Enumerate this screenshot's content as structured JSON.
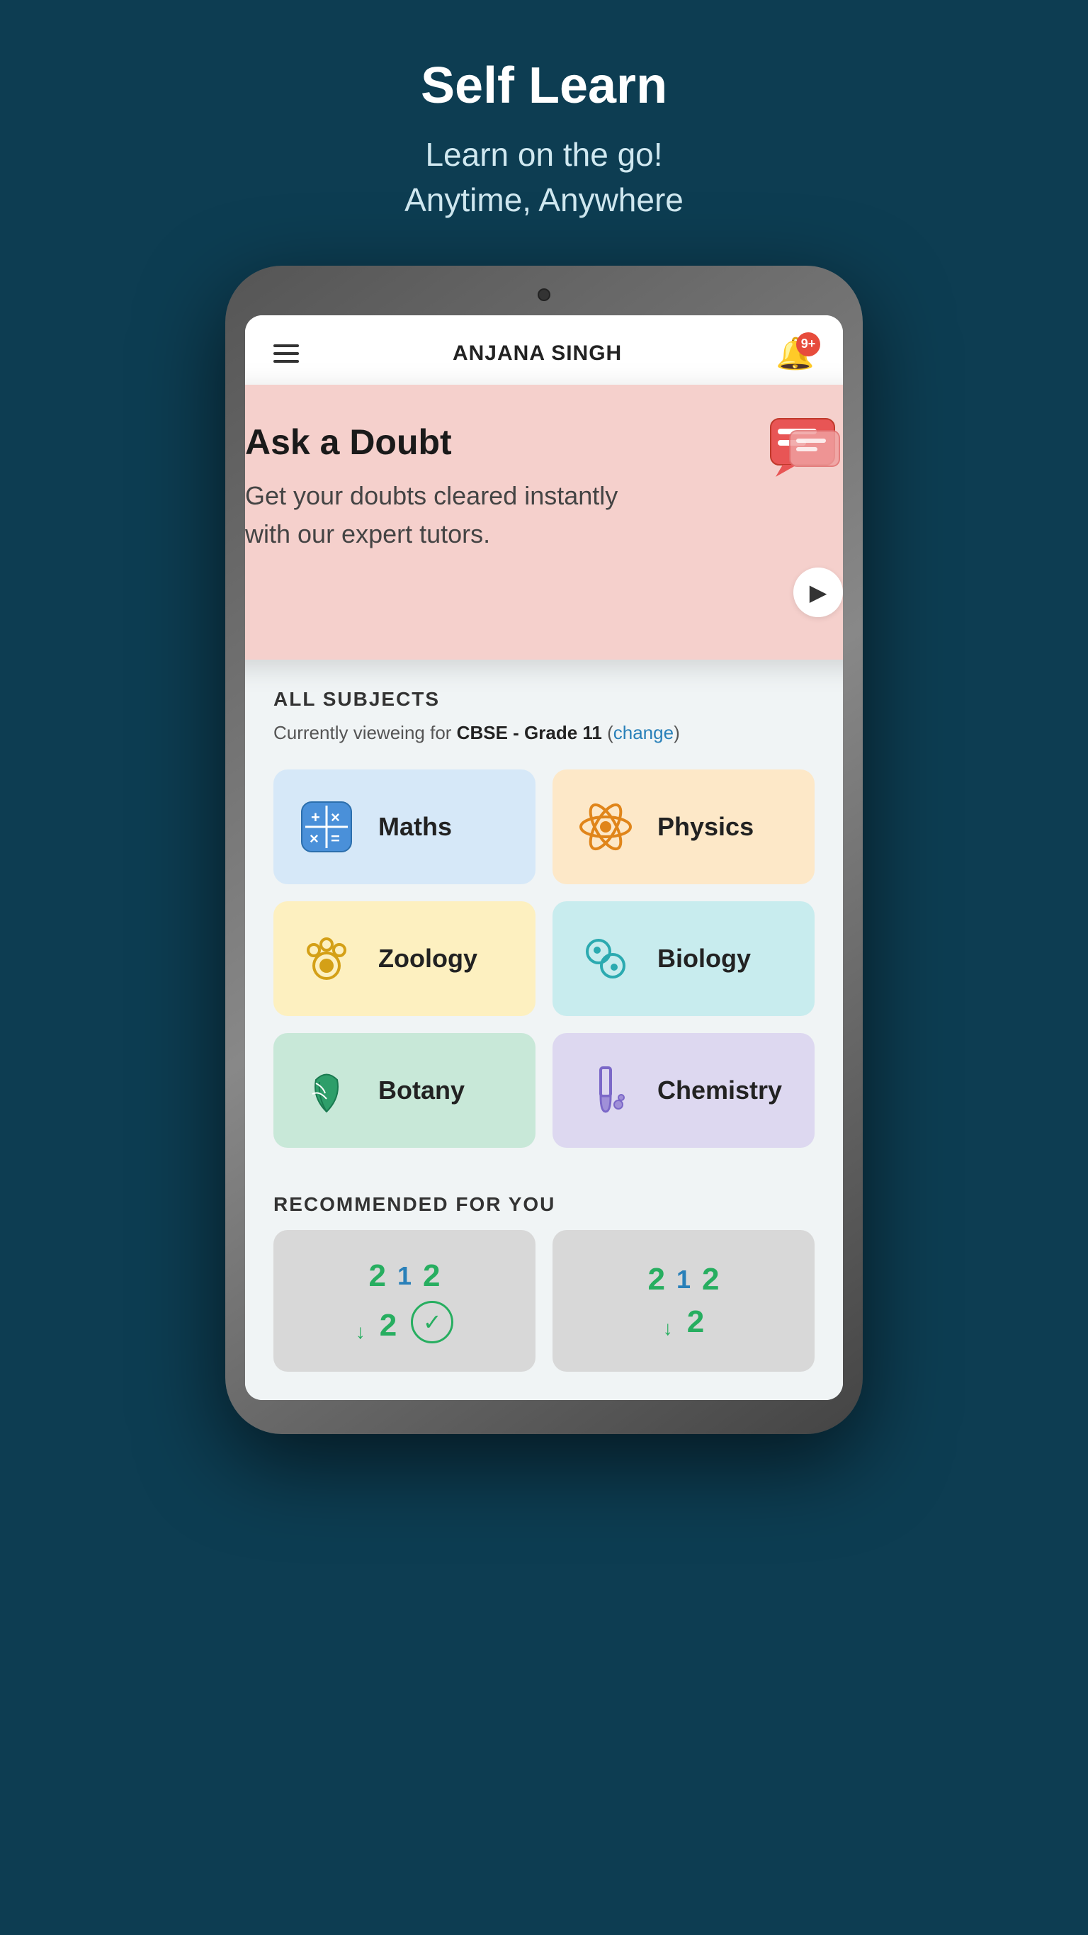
{
  "hero": {
    "title": "Self Learn",
    "subtitle_line1": "Learn on the go!",
    "subtitle_line2": "Anytime, Anywhere"
  },
  "app_header": {
    "username": "ANJANA SINGH",
    "notification_badge": "9+"
  },
  "doubt_card": {
    "title": "Ask a Doubt",
    "description": "Get your doubts cleared instantly with our expert tutors.",
    "icon": "💬",
    "arrow": "▶"
  },
  "subjects": {
    "section_title": "ALL SUBJECTS",
    "viewing_label": "Currently vieweing for",
    "viewing_bold": "CBSE - Grade 11",
    "change_label": "change",
    "items": [
      {
        "name": "Maths",
        "theme": "maths",
        "icon": "🔢"
      },
      {
        "name": "Physics",
        "theme": "physics",
        "icon": "⚛"
      },
      {
        "name": "Zoology",
        "theme": "zoology",
        "icon": "🐾"
      },
      {
        "name": "Biology",
        "theme": "biology",
        "icon": "🔬"
      },
      {
        "name": "Botany",
        "theme": "botany",
        "icon": "🌿"
      },
      {
        "name": "Chemistry",
        "theme": "chemistry",
        "icon": "🧪"
      }
    ]
  },
  "recommended": {
    "section_title": "RECOMMENDED FOR YOU"
  }
}
